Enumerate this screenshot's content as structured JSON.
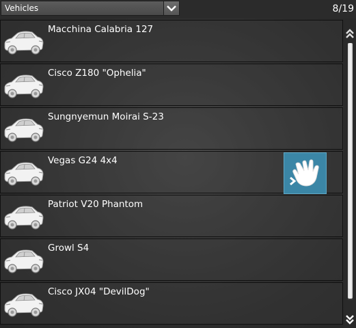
{
  "header": {
    "category": "Vehicles",
    "count": "8/19"
  },
  "vehicles": [
    {
      "name": "Macchina Calabria 127",
      "icon": "car-icon"
    },
    {
      "name": "Cisco Z180 \"Ophelia\"",
      "icon": "car-icon"
    },
    {
      "name": "Sungnyemun Moirai S-23",
      "icon": "car-icon"
    },
    {
      "name": "Vegas G24 4x4",
      "icon": "car-icon"
    },
    {
      "name": "Patriot V20 Phantom",
      "icon": "car-icon"
    },
    {
      "name": "Growl S4",
      "icon": "car-icon"
    },
    {
      "name": "Cisco JX04 \"DevilDog\"",
      "icon": "car-icon"
    }
  ],
  "action": {
    "icon": "hand-grab-icon",
    "color": "#3b86a6"
  }
}
